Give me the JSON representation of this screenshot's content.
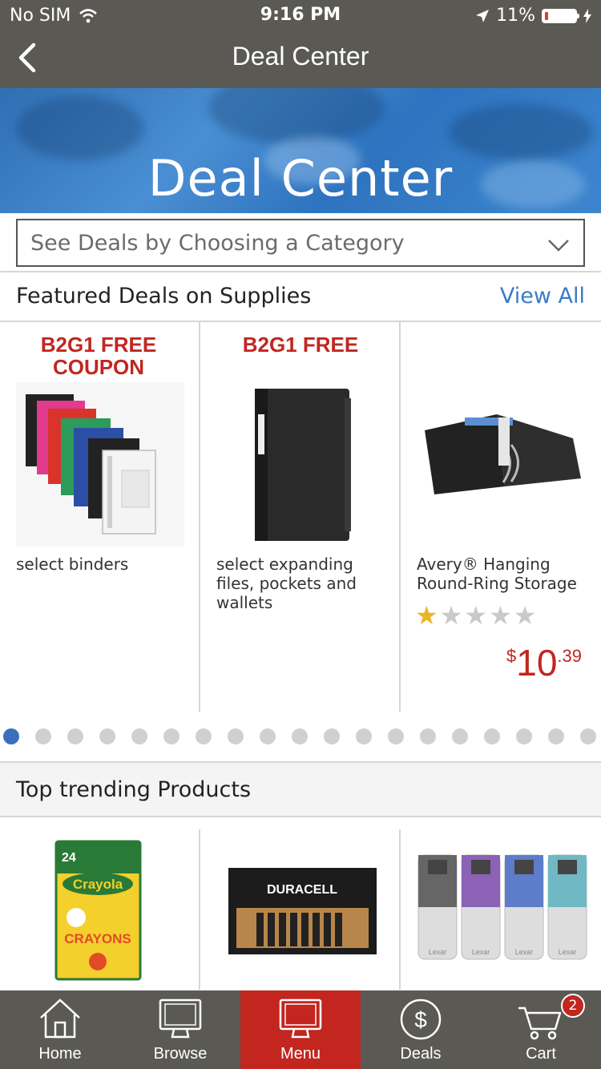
{
  "status_bar": {
    "carrier": "No SIM",
    "time": "9:16 PM",
    "battery": "11%",
    "battery_level": 0.11
  },
  "nav": {
    "title": "Deal Center"
  },
  "hero": {
    "title": "Deal Center"
  },
  "category_select": {
    "value": "See Deals by Choosing a Category"
  },
  "featured": {
    "title": "Featured Deals on Supplies",
    "view_all": "View All",
    "items": [
      {
        "badge": "B2G1 FREE COUPON",
        "description": "select binders"
      },
      {
        "badge": "B2G1 FREE",
        "description": "select expanding files, pockets and wallets"
      },
      {
        "badge": "",
        "description": "Avery® Hanging Round-Ring Storage",
        "rating": 1,
        "rating_max": 5,
        "price_currency": "$",
        "price_whole": "10",
        "price_cents": ".39"
      }
    ],
    "pager": {
      "total": 19,
      "active": 0
    }
  },
  "trending": {
    "title": "Top trending Products",
    "items": [
      {
        "image": "crayola-crayons-24",
        "box_count": "24",
        "brand": "Crayola",
        "product": "CRAYONS"
      },
      {
        "image": "duracell-batteries",
        "brand": "DURACELL"
      },
      {
        "image": "lexar-usb-drives",
        "brand": "Lexar"
      }
    ]
  },
  "tab_bar": {
    "tabs": [
      {
        "label": "Home",
        "icon": "home-icon"
      },
      {
        "label": "Browse",
        "icon": "monitor-icon"
      },
      {
        "label": "Menu",
        "icon": "monitor-icon",
        "active": true
      },
      {
        "label": "Deals",
        "icon": "dollar-circle-icon"
      },
      {
        "label": "Cart",
        "icon": "cart-icon",
        "badge": "2"
      }
    ]
  },
  "colors": {
    "bar": "#5a5954",
    "accent_red": "#c2261f",
    "link_blue": "#3a7bc5",
    "star_gold": "#e9b528"
  }
}
